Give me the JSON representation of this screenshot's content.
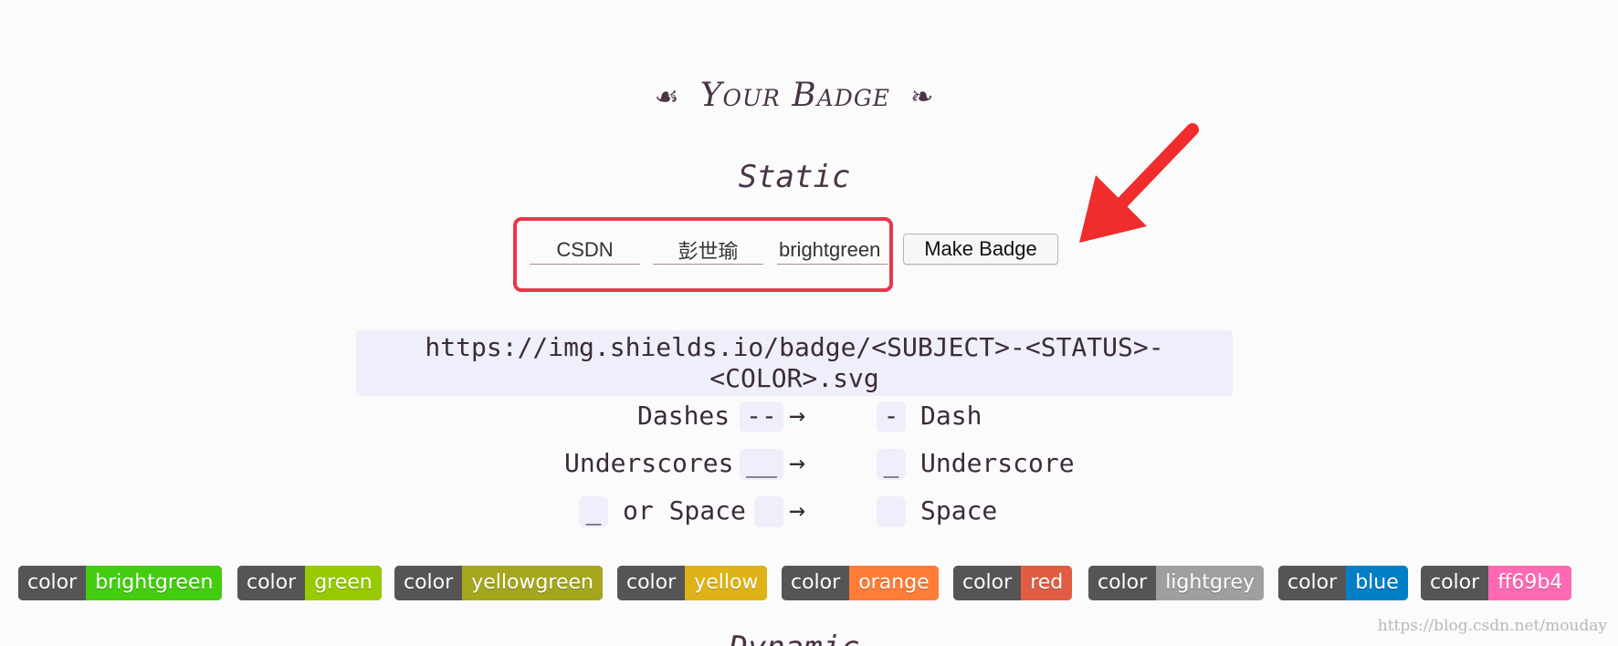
{
  "header": {
    "title": "Your Badge",
    "ornament_left": "☙",
    "ornament_right": "❧",
    "subtitle": "Static"
  },
  "form": {
    "subject_value": "CSDN",
    "status_value": "彭世瑜",
    "color_value": "brightgreen",
    "make_button_label": "Make Badge"
  },
  "url_pattern": "https://img.shields.io/badge/<SUBJECT>-<STATUS>-<COLOR>.svg",
  "rules": [
    {
      "label": "Dashes",
      "input": "--",
      "arrow": "→",
      "output": "-",
      "result": "Dash"
    },
    {
      "label": "Underscores",
      "input": "__",
      "arrow": "→",
      "output": "_",
      "result": "Underscore"
    },
    {
      "prefix": "_",
      "label": "or Space",
      "input": "",
      "arrow": "→",
      "output": "",
      "result": "Space"
    }
  ],
  "badges": [
    {
      "label": "color",
      "value": "brightgreen",
      "color": "#4c1"
    },
    {
      "label": "color",
      "value": "green",
      "color": "#97ca00"
    },
    {
      "label": "color",
      "value": "yellowgreen",
      "color": "#a4a61d"
    },
    {
      "label": "color",
      "value": "yellow",
      "color": "#dfb317"
    },
    {
      "label": "color",
      "value": "orange",
      "color": "#fe7d37"
    },
    {
      "label": "color",
      "value": "red",
      "color": "#e05d44"
    },
    {
      "label": "color",
      "value": "lightgrey",
      "color": "#9f9f9f"
    },
    {
      "label": "color",
      "value": "blue",
      "color": "#007ec6"
    },
    {
      "label": "color",
      "value": "ff69b4",
      "color": "#ff69b4"
    }
  ],
  "next_section": "Dynamic",
  "watermark": "https://blog.csdn.net/mouday",
  "accent_colors": {
    "highlight_box": "#e8364a",
    "arrow": "#f02c2c",
    "code_bg": "#efeefb"
  }
}
